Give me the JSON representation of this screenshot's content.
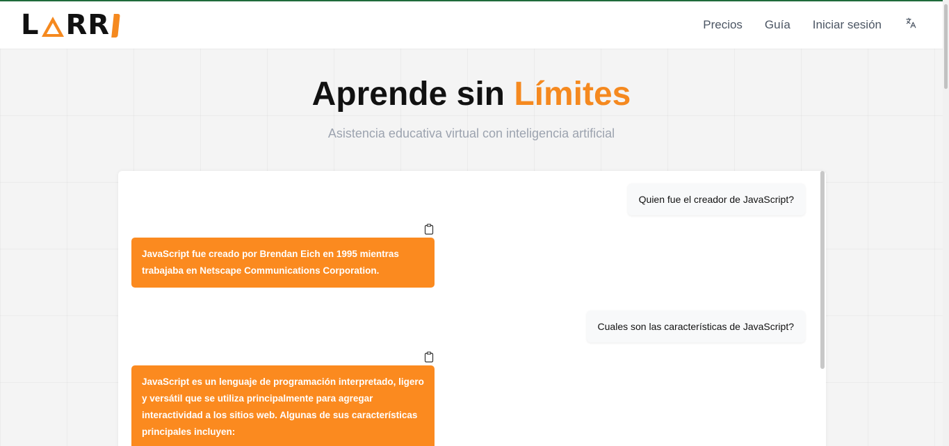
{
  "colors": {
    "accent": "#f5891f",
    "bot_bubble": "#fb8a1f",
    "top_line": "#1f6b3a"
  },
  "logo": {
    "letter_l": "L",
    "letters_rr": "RR",
    "alt": "LARRI"
  },
  "nav": {
    "items": [
      {
        "label": "Precios"
      },
      {
        "label": "Guía"
      },
      {
        "label": "Iniciar sesión"
      }
    ],
    "language_icon": "translate-icon"
  },
  "hero": {
    "title_main": "Aprende sin ",
    "title_accent": "Límites",
    "subtitle": "Asistencia educativa virtual con inteligencia artificial"
  },
  "chat": {
    "messages": [
      {
        "role": "user",
        "text": "Quien fue el creador de JavaScript?"
      },
      {
        "role": "assistant",
        "text": "JavaScript fue creado por Brendan Eich en 1995 mientras trabajaba en Netscape Communications Corporation.",
        "icon": "clipboard-icon"
      },
      {
        "role": "user",
        "text": "Cuales son las características de JavaScript?"
      },
      {
        "role": "assistant",
        "text": "JavaScript es un lenguaje de programación interpretado, ligero y versátil que se utiliza principalmente para agregar interactividad a los sitios web. Algunas de sus características principales incluyen:",
        "icon": "clipboard-icon"
      }
    ]
  }
}
